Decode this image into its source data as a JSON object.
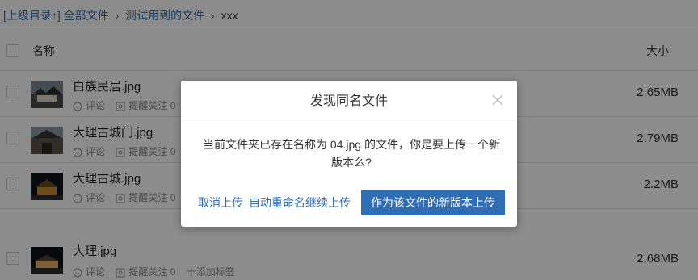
{
  "breadcrumb": {
    "up": "[上级目录↑]",
    "items": [
      "全部文件",
      "测试用到的文件",
      "xxx"
    ],
    "separator": "›"
  },
  "header": {
    "name": "名称",
    "size": "大小"
  },
  "files": [
    {
      "name": "白族民居.jpg",
      "size": "2.65MB",
      "comment": "评论",
      "remind": "提醒关注 0"
    },
    {
      "name": "大理古城门.jpg",
      "size": "2.79MB",
      "comment": "评论",
      "remind": "提醒关注 0"
    },
    {
      "name": "大理古城.jpg",
      "size": "2.2MB",
      "comment": "评论",
      "remind": "提醒关注 0"
    },
    {
      "name": "大理.jpg",
      "size": "2.68MB",
      "comment": "评论",
      "remind": "提醒关注 0",
      "tag": "十添加标签"
    }
  ],
  "dialog": {
    "title": "发现同名文件",
    "message_line1": "当前文件夹已存在名称为 04.jpg 的文件，你是要上传一个新",
    "message_line2": "版本么?",
    "cancel": "取消上传",
    "rename": "自动重命名继续上传",
    "new_version": "作为该文件的新版本上传"
  },
  "colors": {
    "link": "#2f6db5",
    "primary": "#2f6db5",
    "overlay": "rgba(0,0,0,0.45)"
  },
  "icons": [
    "comment-icon",
    "remind-icon",
    "close-icon"
  ]
}
